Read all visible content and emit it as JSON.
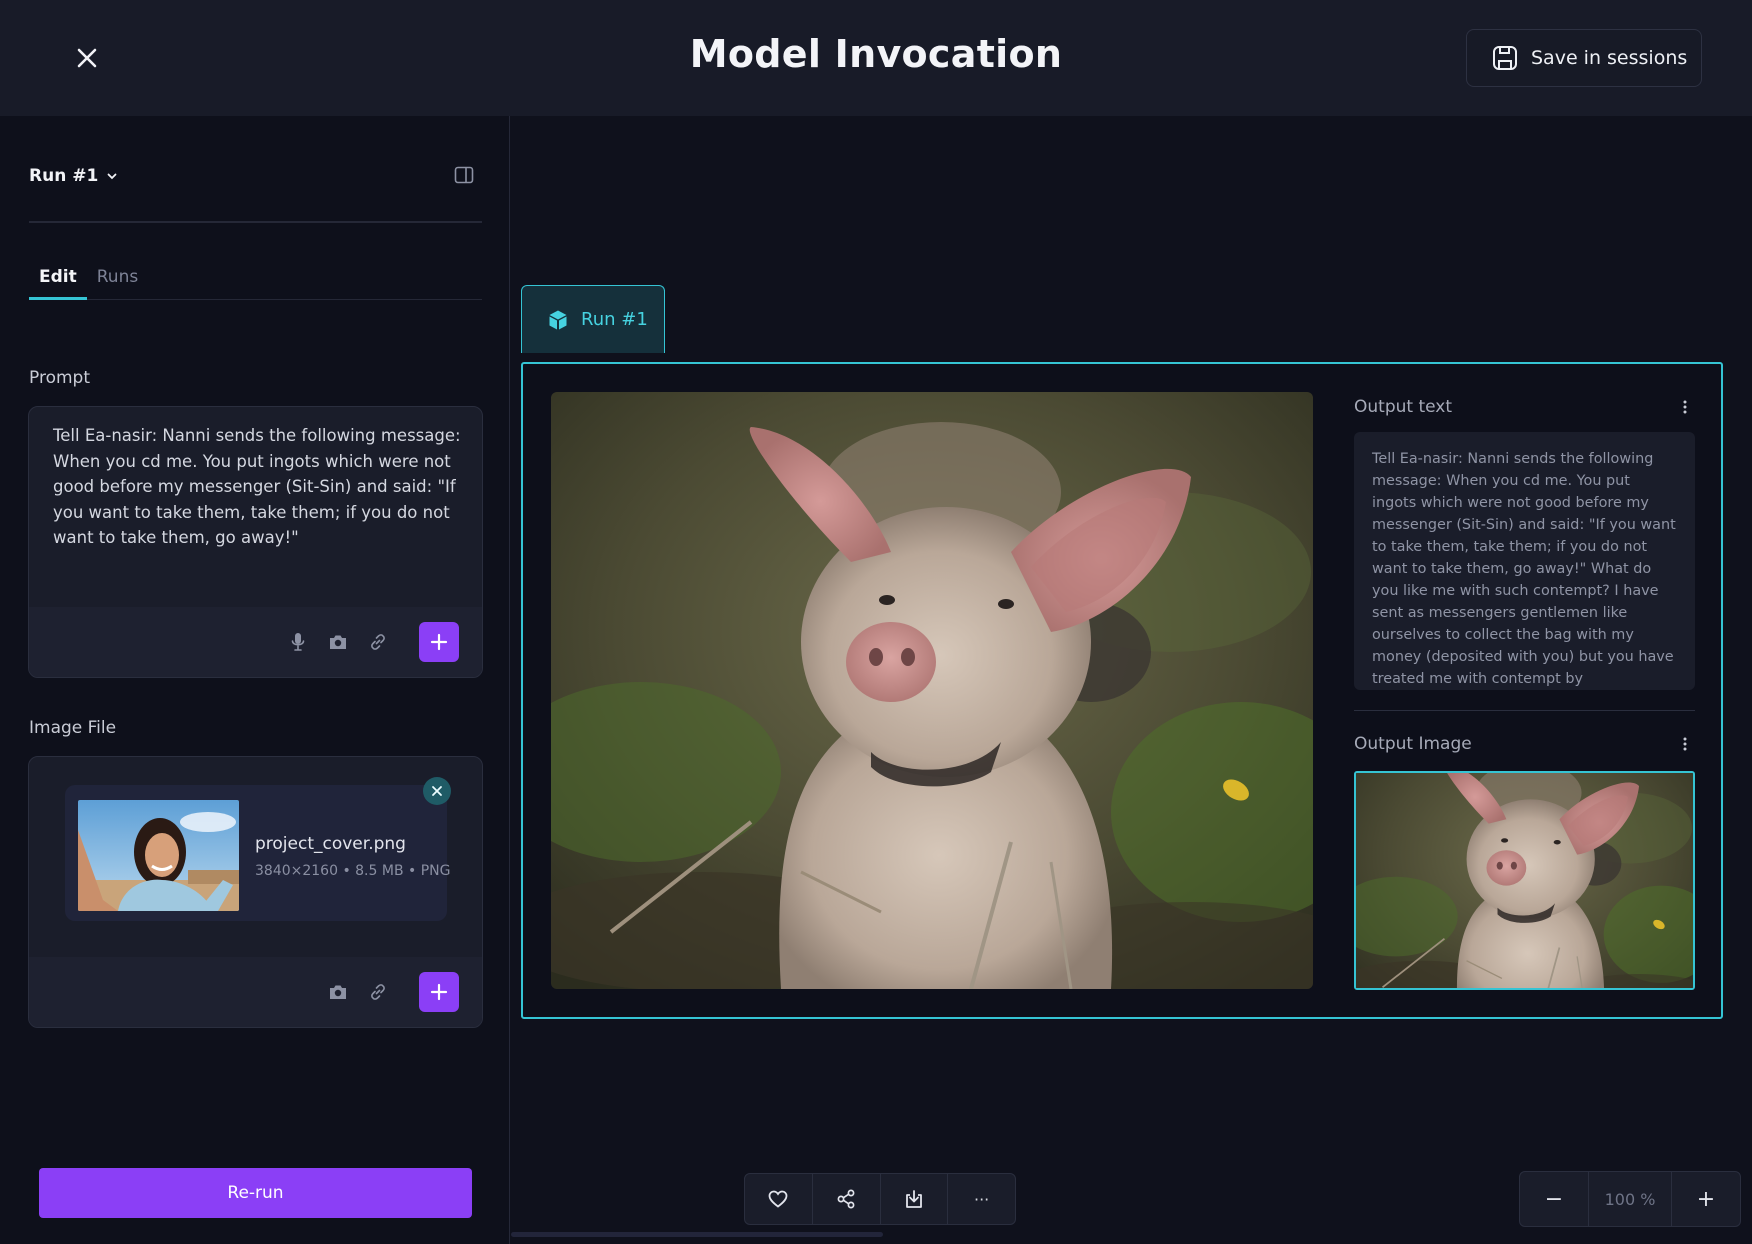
{
  "header": {
    "title": "Model Invocation",
    "save_label": "Save in sessions"
  },
  "sidebar": {
    "run_selector": "Run #1",
    "tabs": [
      {
        "label": "Edit",
        "active": true
      },
      {
        "label": "Runs",
        "active": false
      }
    ],
    "prompt": {
      "label": "Prompt",
      "text": "Tell Ea-nasir: Nanni sends the following message: When you cd me. You put ingots which were not good before my messenger (Sit-Sin) and said: \"If you want to take them, take them; if you do not want to take them, go away!\""
    },
    "image_file": {
      "label": "Image File",
      "file_name": "project_cover.png",
      "meta": "3840×2160 • 8.5 MB • PNG"
    },
    "rerun_label": "Re-run"
  },
  "canvas": {
    "run_tab_label": "Run #1",
    "output_text_label": "Output text",
    "output_text": "Tell Ea-nasir: Nanni sends the following message:  When you cd me. You put ingots which were not good before my messenger (Sit-Sin) and said: \"If you want to take them, take them; if you do not want to take them, go away!\"  What do you  like me with such contempt? I have sent as messengers gentlemen like ourselves to collect the bag with my money (deposited with you) but you have treated me with contempt by",
    "output_image_label": "Output Image"
  },
  "toolbar": {
    "more_label": "···"
  },
  "zoom": {
    "minus": "−",
    "value": "100 %",
    "plus": "+"
  },
  "colors": {
    "accent": "#35c4d4",
    "primary": "#8b3ff6",
    "background": "#0f111c"
  }
}
